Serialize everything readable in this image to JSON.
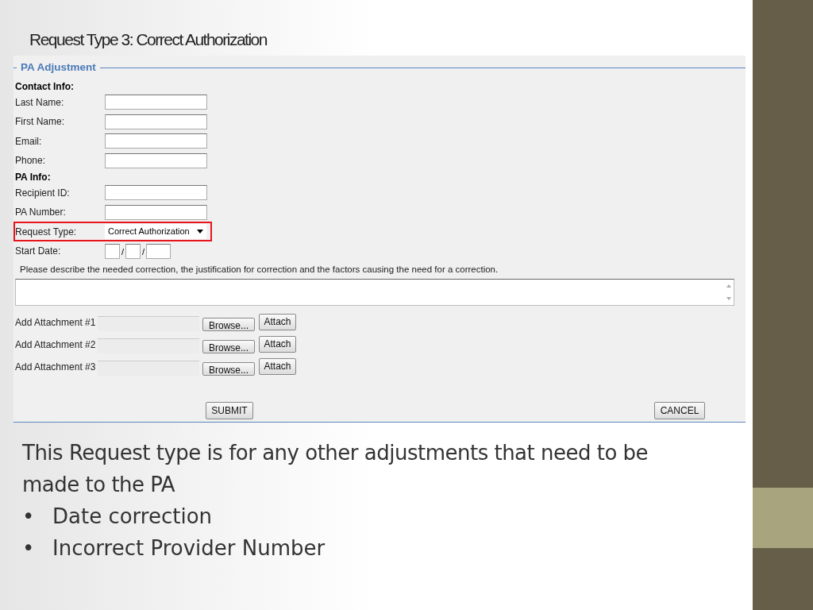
{
  "slide_title": "Request Type 3: Correct Authorization",
  "form": {
    "legend": "PA Adjustment",
    "sections": [
      {
        "heading": "Contact Info:",
        "fields": [
          {
            "kind": "text",
            "label": "Last Name:",
            "highlighted": false
          },
          {
            "kind": "text",
            "label": "First Name:",
            "highlighted": false
          },
          {
            "kind": "text",
            "label": "Email:",
            "highlighted": false
          },
          {
            "kind": "text",
            "label": "Phone:",
            "highlighted": false
          }
        ]
      },
      {
        "heading": "PA Info:",
        "fields": [
          {
            "kind": "text",
            "label": "Recipient ID:",
            "highlighted": false
          },
          {
            "kind": "text",
            "label": "PA Number:",
            "highlighted": false
          },
          {
            "kind": "select",
            "label": "Request Type:",
            "value": "Correct Authorization",
            "highlighted": true
          },
          {
            "kind": "date",
            "label": "Start Date:",
            "separators": [
              "/",
              "/"
            ],
            "highlighted": false
          }
        ]
      }
    ],
    "description_prompt": "Please describe the needed correction, the justification for correction and the factors causing the need for a correction.",
    "attachments": [
      {
        "label": "Add Attachment #1",
        "browse": "Browse...",
        "attach": "Attach"
      },
      {
        "label": "Add Attachment #2",
        "browse": "Browse...",
        "attach": "Attach"
      },
      {
        "label": "Add Attachment #3",
        "browse": "Browse...",
        "attach": "Attach"
      }
    ],
    "submit": "SUBMIT",
    "cancel": "CANCEL"
  },
  "body": {
    "text": "This Request type is for any other adjustments that need to be made to the PA",
    "bullets": [
      {
        "marker": "•",
        "text": "Date correction"
      },
      {
        "marker": "•",
        "text": "Incorrect Provider Number"
      }
    ]
  }
}
